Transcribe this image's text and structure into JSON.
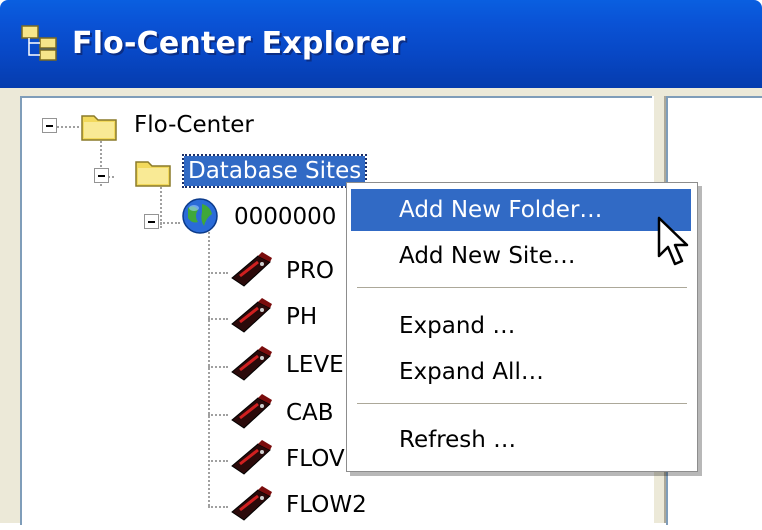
{
  "window": {
    "title": "Flo-Center Explorer",
    "title_icon": "tree-view-icon"
  },
  "tree": {
    "root": {
      "label": "Flo-Center",
      "icon": "folder-icon",
      "expanded": true
    },
    "database_sites": {
      "label": "Database Sites",
      "icon": "folder-icon",
      "expanded": true,
      "selected": true
    },
    "site": {
      "label": "0000000",
      "icon": "globe-icon",
      "expanded": true
    },
    "monitors": [
      {
        "label": "PRO",
        "icon": "monitor-device-icon"
      },
      {
        "label": "PH",
        "icon": "monitor-device-icon"
      },
      {
        "label": "LEVE",
        "icon": "monitor-device-icon"
      },
      {
        "label": "CAB",
        "icon": "monitor-device-icon"
      },
      {
        "label": "FLOV",
        "icon": "monitor-device-icon"
      },
      {
        "label": "FLOW2",
        "icon": "monitor-device-icon"
      }
    ]
  },
  "context_menu": {
    "items": [
      {
        "label": "Add New Folder…",
        "highlighted": true
      },
      {
        "label": "Add New Site…",
        "highlighted": false
      },
      {
        "label": "Expand …",
        "highlighted": false
      },
      {
        "label": "Expand All…",
        "highlighted": false
      },
      {
        "label": "Refresh …",
        "highlighted": false
      }
    ]
  },
  "colors": {
    "titlebar": "#0a53d6",
    "selection": "#316ac5",
    "window_face": "#ece9d8",
    "folder_yellow": "#f2d95c"
  }
}
